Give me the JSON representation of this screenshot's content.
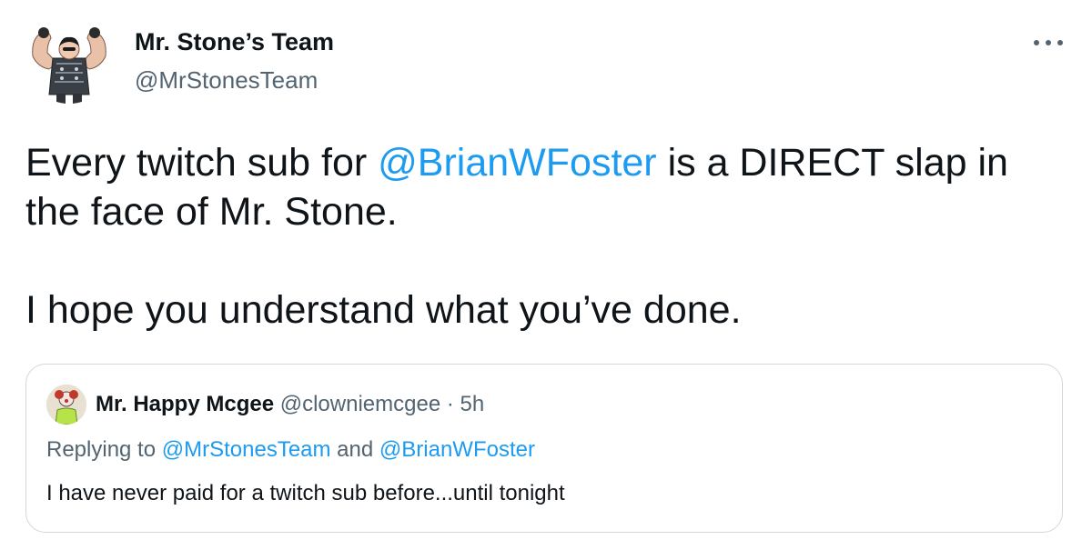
{
  "author": {
    "name": "Mr. Stone’s Team",
    "handle": "@MrStonesTeam",
    "avatar_icon": "bodybuilder-avatar"
  },
  "more_icon": "more-horizontal-icon",
  "tweet": {
    "line1_pre": "Every twitch sub for ",
    "line1_mention": "@BrianWFoster",
    "line1_post": " is a DIRECT slap in the face of Mr. Stone.",
    "line2": "I hope you understand what you’ve done."
  },
  "quoted_tweet": {
    "name": "Mr. Happy Mcgee",
    "handle": "@clowniemcgee",
    "separator": " · ",
    "time": "5h",
    "avatar_icon": "clown-avatar",
    "replying_to_label": "Replying to ",
    "reply_mention_1": "@MrStonesTeam",
    "reply_and": " and ",
    "reply_mention_2": "@BrianWFoster",
    "text": "I have never paid for a twitch sub before...until tonight"
  },
  "colors": {
    "link": "#1d9bf0",
    "text": "#0f1419",
    "secondary": "#536471",
    "border": "#cfd9de"
  }
}
